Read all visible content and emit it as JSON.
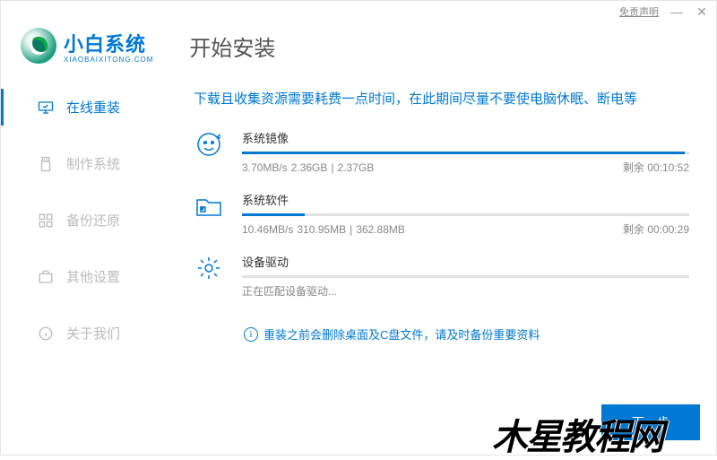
{
  "window": {
    "disclaimer_link": "免责声明",
    "minimize": "—",
    "close": "✕"
  },
  "brand": {
    "name": "小白系统",
    "sub": "XIAOBAIXITONG.COM"
  },
  "page_title": "开始安装",
  "sidebar": {
    "items": [
      {
        "label": "在线重装",
        "active": true
      },
      {
        "label": "制作系统",
        "active": false
      },
      {
        "label": "备份还原",
        "active": false
      },
      {
        "label": "其他设置",
        "active": false
      },
      {
        "label": "关于我们",
        "active": false
      }
    ]
  },
  "hint": "下载且收集资源需要耗费一点时间，在此期间尽量不要使电脑休眠、断电等",
  "tasks": [
    {
      "title": "系统镜像",
      "speed": "3.70MB/s",
      "done": "2.36GB",
      "sep": "|",
      "total": "2.37GB",
      "remain_label": "剩余",
      "remain_time": "00:10:52",
      "progress_pct": 99
    },
    {
      "title": "系统软件",
      "speed": "10.46MB/s",
      "done": "310.95MB",
      "sep": "|",
      "total": "362.88MB",
      "remain_label": "剩余",
      "remain_time": "00:00:29",
      "progress_pct": 14
    },
    {
      "title": "设备驱动",
      "status": "正在匹配设备驱动...",
      "progress_pct": 0
    }
  ],
  "notice": "重装之前会删除桌面及C盘文件，请及时备份重要资料",
  "primary_button": "下一步",
  "watermark": "木星教程网"
}
